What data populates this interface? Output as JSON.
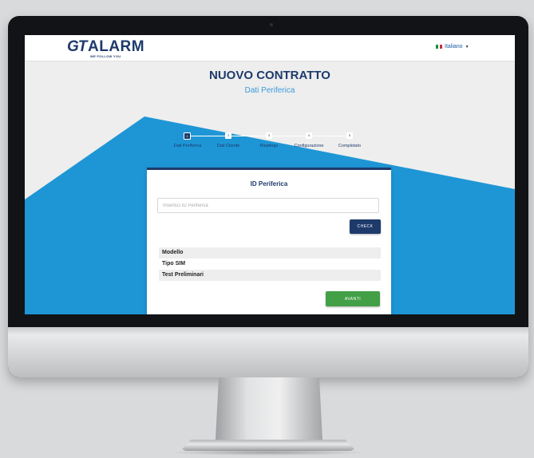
{
  "brand": {
    "logo_mark": "GT",
    "logo_name": "ALARM",
    "tagline": "WE FOLLOW YOU"
  },
  "language": {
    "selected": "Italiano",
    "flag_colors": [
      "#009246",
      "#ffffff",
      "#ce2b37"
    ],
    "icon": "chevron-down-icon"
  },
  "page": {
    "title": "NUOVO CONTRATTO",
    "subtitle": "Dati Periferica"
  },
  "stepper": {
    "active_index": 0,
    "steps": [
      {
        "number": "1",
        "label": "Dati Periferica"
      },
      {
        "number": "2",
        "label": "Dati Cliente"
      },
      {
        "number": "3",
        "label": "Riepilogo"
      },
      {
        "number": "4",
        "label": "Configurazione"
      },
      {
        "number": "5",
        "label": "Completato"
      }
    ]
  },
  "card": {
    "title": "ID Periferica",
    "input_placeholder": "Inserisci ID Periferica",
    "input_value": "",
    "check_label": "CHECK",
    "rows": [
      "Modello",
      "Tipo SIM",
      "Test Preliminari"
    ],
    "next_label": "AVANTI"
  },
  "colors": {
    "primary": "#1d3a6b",
    "accent_blue": "#1e96d6",
    "success": "#43a047"
  }
}
